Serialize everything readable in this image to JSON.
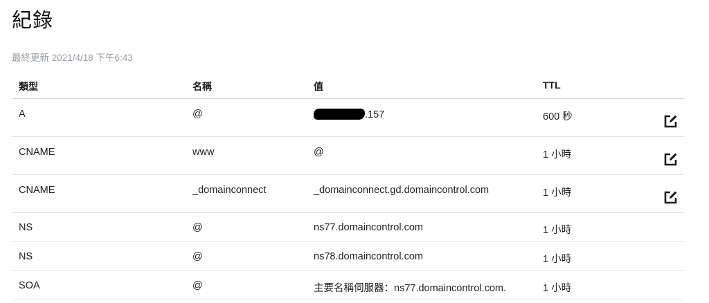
{
  "page": {
    "title": "紀錄",
    "last_updated": "最終更新 2021/4/18 下午6:43"
  },
  "table": {
    "headers": {
      "type": "類型",
      "name": "名稱",
      "value": "值",
      "ttl": "TTL"
    },
    "rows": [
      {
        "type": "A",
        "name": "@",
        "value": ".157",
        "value_redacted": true,
        "ttl": "600 秒",
        "editable": true
      },
      {
        "type": "CNAME",
        "name": "www",
        "value": "@",
        "ttl": "1 小時",
        "editable": true
      },
      {
        "type": "CNAME",
        "name": "_domainconnect",
        "value": "_domainconnect.gd.domaincontrol.com",
        "ttl": "1 小時",
        "editable": true
      },
      {
        "type": "NS",
        "name": "@",
        "value": "ns77.domaincontrol.com",
        "ttl": "1 小時",
        "editable": false
      },
      {
        "type": "NS",
        "name": "@",
        "value": "ns78.domaincontrol.com",
        "ttl": "1 小時",
        "editable": false
      },
      {
        "type": "SOA",
        "name": "@",
        "value": "主要名稱伺服器：ns77.domaincontrol.com.",
        "ttl": "1 小時",
        "editable": false
      }
    ]
  },
  "icons": {
    "edit": "edit-icon"
  },
  "colors": {
    "text": "#222222",
    "muted": "#9a9fa6",
    "divider": "#e4e4e4"
  }
}
